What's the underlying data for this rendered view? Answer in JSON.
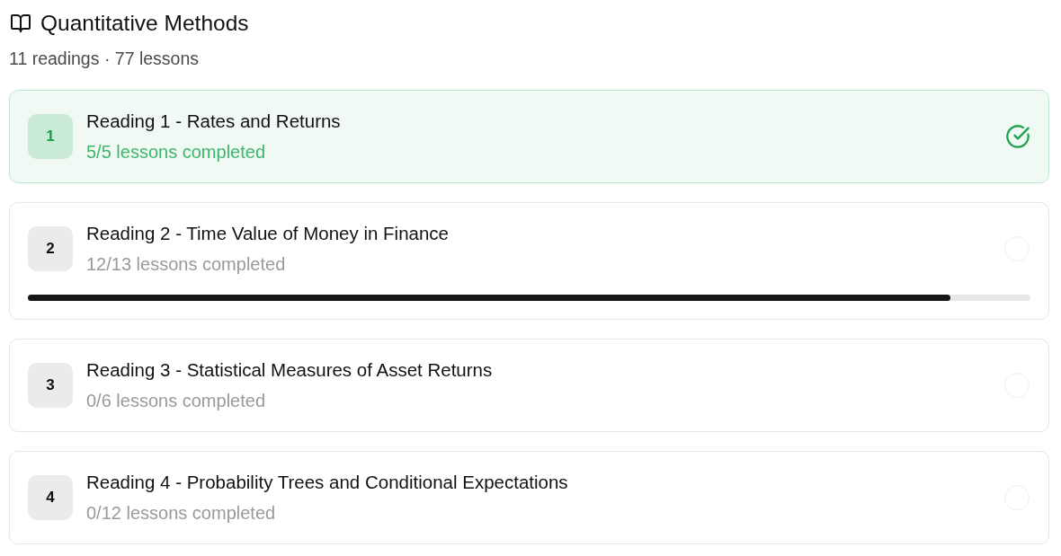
{
  "header": {
    "title": "Quantitative Methods",
    "summary": "11 readings · 77 lessons"
  },
  "readings": [
    {
      "number": "1",
      "title": "Reading 1 - Rates and Returns",
      "progress_text": "5/5 lessons completed",
      "completed": true
    },
    {
      "number": "2",
      "title": "Reading 2 - Time Value of Money in Finance",
      "progress_text": "12/13 lessons completed",
      "completed": false,
      "level": 0.92
    },
    {
      "number": "3",
      "title": "Reading 3 - Statistical Measures of Asset Returns",
      "progress_text": "0/6 lessons completed",
      "completed": false
    },
    {
      "number": "4",
      "title": "Reading 4 - Probability Trees and Conditional Expectations",
      "progress_text": "0/12 lessons completed",
      "completed": false
    }
  ]
}
